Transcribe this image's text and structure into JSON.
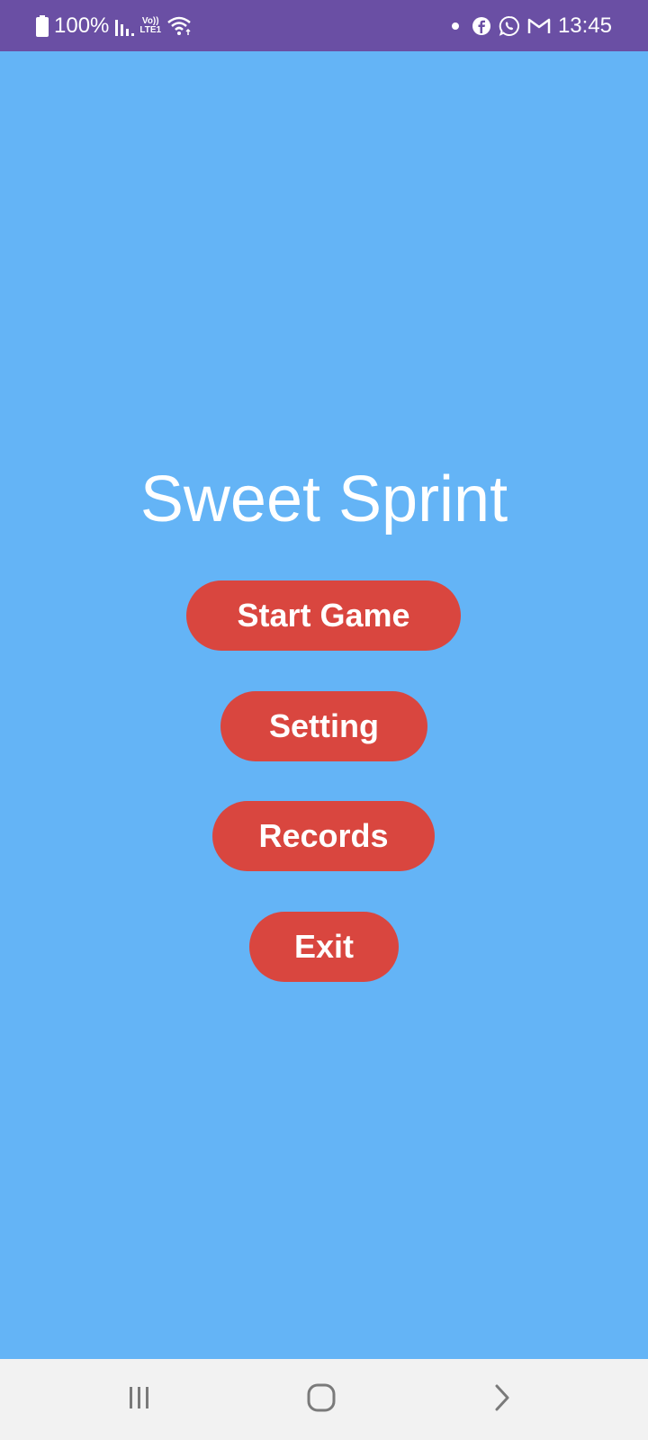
{
  "status_bar": {
    "battery_text": "100%",
    "lte_top": "Vo))",
    "lte_bottom": "LTE1",
    "time": "13:45",
    "icons": [
      "battery-icon",
      "signal-icon",
      "volte-lte-icon",
      "wifi-icon",
      "notification-dot-icon",
      "facebook-icon",
      "whatsapp-icon",
      "gmail-icon"
    ]
  },
  "app": {
    "title": "Sweet Sprint",
    "background_color": "#64b4f6",
    "button_color": "#d9463f"
  },
  "menu": {
    "start_label": "Start Game",
    "setting_label": "Setting",
    "records_label": "Records",
    "exit_label": "Exit"
  },
  "nav_bar": {
    "icons": [
      "recents-icon",
      "home-icon",
      "back-icon"
    ]
  }
}
